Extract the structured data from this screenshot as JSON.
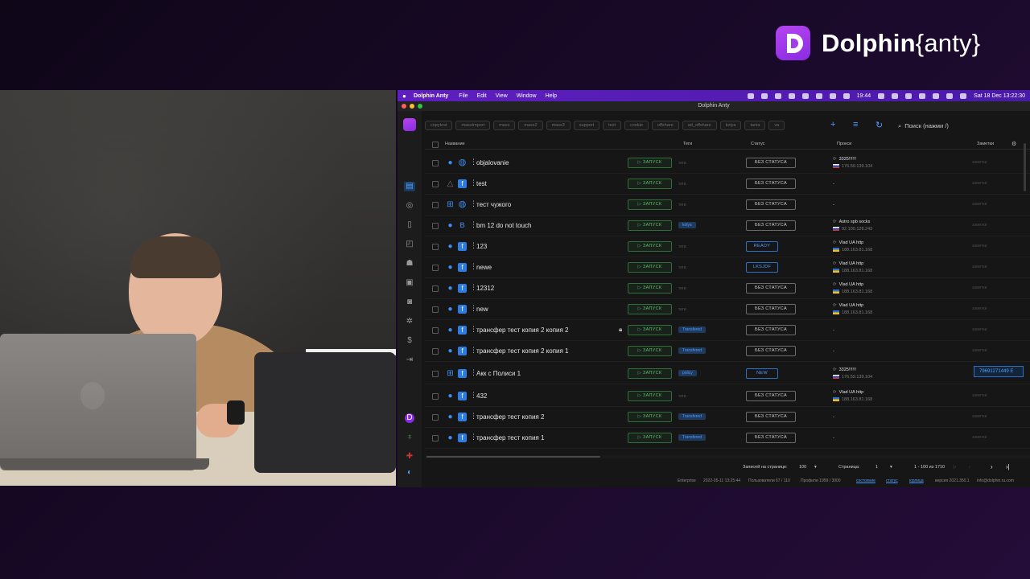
{
  "brand": {
    "name_bold": "Dolphin",
    "name_light": "{anty}",
    "logo_letter": "D"
  },
  "menubar": {
    "app_name": "Dolphin Anty",
    "items": [
      "File",
      "Edit",
      "View",
      "Window",
      "Help"
    ],
    "time": "19:44",
    "datetime": "Sat 18 Dec  13:22:30"
  },
  "window": {
    "title": "Dolphin Anty"
  },
  "toolbar": {
    "tags": [
      "copytest",
      "massImport",
      "mass",
      "mass2",
      "mass3",
      "support",
      "test",
      "cookie",
      "offshare",
      "ad_offshare",
      "kolya",
      "tania",
      "va"
    ],
    "search_placeholder": "Поиск (нажми /)"
  },
  "table": {
    "headers": {
      "name": "Название",
      "tags": "Теги",
      "status": "Статус",
      "proxy": "Прокси",
      "notes": "Заметки"
    },
    "run_label": "ЗАПУСК",
    "rows": [
      {
        "os": "apple",
        "browser": "globe",
        "name": "objalovanie",
        "tag": "теги",
        "tag_pill": false,
        "status": "БЕЗ СТАТУСА",
        "status_blue": false,
        "proxy_name": "3325!!!!!!",
        "proxy_ip": "176.59.139.104",
        "flag": "ru",
        "note": "заметки",
        "lock": false
      },
      {
        "os": "linux",
        "browser": "fb",
        "name": "test",
        "tag": "теги",
        "tag_pill": false,
        "status": "БЕЗ СТАТУСА",
        "status_blue": false,
        "proxy_name": "-",
        "proxy_ip": "",
        "flag": "",
        "note": "заметки",
        "lock": false
      },
      {
        "os": "windows",
        "browser": "globe",
        "name": "тест чужого",
        "tag": "теги",
        "tag_pill": false,
        "status": "БЕЗ СТАТУСА",
        "status_blue": false,
        "proxy_name": "-",
        "proxy_ip": "",
        "flag": "",
        "note": "заметки",
        "lock": false
      },
      {
        "os": "apple",
        "browser": "bt",
        "name": "bm 12 do not touch",
        "tag": "kolya",
        "tag_pill": true,
        "status": "БЕЗ СТАТУСА",
        "status_blue": false,
        "proxy_name": "Astro spb socks",
        "proxy_ip": "92.100.128.243",
        "flag": "ru",
        "note": "заметки",
        "lock": false
      },
      {
        "os": "apple",
        "browser": "fb",
        "name": "123",
        "tag": "теги",
        "tag_pill": false,
        "status": "READY",
        "status_blue": true,
        "proxy_name": "Vlad UA http",
        "proxy_ip": "188.163.81.168",
        "flag": "ua",
        "note": "заметки",
        "lock": false
      },
      {
        "os": "apple",
        "browser": "fb",
        "name": "newe",
        "tag": "теги",
        "tag_pill": false,
        "status": "LKSJDF",
        "status_blue": true,
        "proxy_name": "Vlad UA http",
        "proxy_ip": "188.163.81.168",
        "flag": "ua",
        "note": "заметки",
        "lock": false
      },
      {
        "os": "apple",
        "browser": "fb",
        "name": "12312",
        "tag": "теги",
        "tag_pill": false,
        "status": "БЕЗ СТАТУСА",
        "status_blue": false,
        "proxy_name": "Vlad UA http",
        "proxy_ip": "188.163.81.168",
        "flag": "ua",
        "note": "заметки",
        "lock": false
      },
      {
        "os": "apple",
        "browser": "fb",
        "name": "new",
        "tag": "теги",
        "tag_pill": false,
        "status": "БЕЗ СТАТУСА",
        "status_blue": false,
        "proxy_name": "Vlad UA http",
        "proxy_ip": "188.163.81.168",
        "flag": "ua",
        "note": "заметки",
        "lock": false
      },
      {
        "os": "apple",
        "browser": "fb",
        "name": "трансфер тест копия 2 копия 2",
        "tag": "Transfered",
        "tag_pill": true,
        "status": "БЕЗ СТАТУСА",
        "status_blue": false,
        "proxy_name": "-",
        "proxy_ip": "",
        "flag": "",
        "note": "заметки",
        "lock": true
      },
      {
        "os": "apple",
        "browser": "fb",
        "name": "трансфер тест копия 2 копия 1",
        "tag": "Transfered",
        "tag_pill": true,
        "status": "БЕЗ СТАТУСА",
        "status_blue": false,
        "proxy_name": "-",
        "proxy_ip": "",
        "flag": "",
        "note": "заметки",
        "lock": false
      },
      {
        "os": "windows",
        "browser": "fb",
        "name": "Акк с Полиси 1",
        "tag": "policy",
        "tag_pill": true,
        "status": "NEW",
        "status_blue": true,
        "proxy_name": "3325!!!!!!",
        "proxy_ip": "176.59.139.104",
        "flag": "ru",
        "note": "79691271449 E",
        "note_filled": true,
        "lock": false
      },
      {
        "os": "apple",
        "browser": "fb",
        "name": "432",
        "tag": "теги",
        "tag_pill": false,
        "status": "БЕЗ СТАТУСА",
        "status_blue": false,
        "proxy_name": "Vlad UA http",
        "proxy_ip": "188.163.81.168",
        "flag": "ua",
        "note": "заметки",
        "lock": false
      },
      {
        "os": "apple",
        "browser": "fb",
        "name": "трансфер тест копия 2",
        "tag": "Transfered",
        "tag_pill": true,
        "status": "БЕЗ СТАТУСА",
        "status_blue": false,
        "proxy_name": "-",
        "proxy_ip": "",
        "flag": "",
        "note": "заметки",
        "lock": false
      },
      {
        "os": "apple",
        "browser": "fb",
        "name": "трансфер тест копия 1",
        "tag": "Transfered",
        "tag_pill": true,
        "status": "БЕЗ СТАТУСА",
        "status_blue": false,
        "proxy_name": "-",
        "proxy_ip": "",
        "flag": "",
        "note": "заметки",
        "lock": false
      }
    ]
  },
  "pager": {
    "per_page_label": "Записей на странице:",
    "per_page_value": "100",
    "page_label": "Страница:",
    "page_value": "1",
    "range": "1 - 100 из 1710"
  },
  "footer": {
    "plan": "Enterprise",
    "expires": "2022-05-11 13:25:44",
    "users": "Пользователи 67 / 110",
    "profiles": "Профили 1959 / 3000",
    "links": [
      "состояние",
      "статус",
      "юрлица"
    ],
    "version": "версия 2021.350.1",
    "email": "info@dolphin.ru.com"
  },
  "colors": {
    "accent": "#4e9bff",
    "brand_purple": "#9b3ff0",
    "run_green": "#5dbb6b"
  }
}
